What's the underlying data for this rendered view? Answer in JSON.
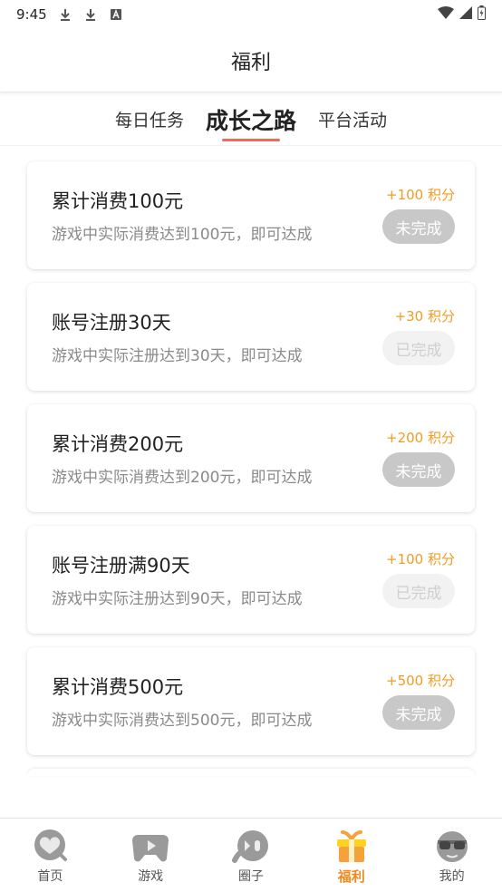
{
  "status_bar": {
    "time": "9:45"
  },
  "header": {
    "title": "福利"
  },
  "tabs": [
    {
      "label": "每日任务",
      "active": false
    },
    {
      "label": "成长之路",
      "active": true
    },
    {
      "label": "平台活动",
      "active": false
    }
  ],
  "tasks": [
    {
      "title": "累计消费100元",
      "desc": "游戏中实际消费达到100元，即可达成",
      "points": "+100 积分",
      "status": "未完成",
      "done": false
    },
    {
      "title": "账号注册30天",
      "desc": "游戏中实际注册达到30天，即可达成",
      "points": "+30 积分",
      "status": "已完成",
      "done": true
    },
    {
      "title": "累计消费200元",
      "desc": "游戏中实际消费达到200元，即可达成",
      "points": "+200 积分",
      "status": "未完成",
      "done": false
    },
    {
      "title": "账号注册满90天",
      "desc": "游戏中实际注册达到90天，即可达成",
      "points": "+100 积分",
      "status": "已完成",
      "done": true
    },
    {
      "title": "累计消费500元",
      "desc": "游戏中实际消费达到500元，即可达成",
      "points": "+500 积分",
      "status": "未完成",
      "done": false
    }
  ],
  "bottom_nav": [
    {
      "label": "首页",
      "icon": "home-heart-icon",
      "active": false
    },
    {
      "label": "游戏",
      "icon": "gamepad-icon",
      "active": false
    },
    {
      "label": "圈子",
      "icon": "chat-bubble-icon",
      "active": false
    },
    {
      "label": "福利",
      "icon": "gift-icon",
      "active": true
    },
    {
      "label": "我的",
      "icon": "profile-face-icon",
      "active": false
    }
  ],
  "colors": {
    "accent": "#f08a1c",
    "tab_underline": "#f06a5a",
    "points": "#f39c23"
  }
}
